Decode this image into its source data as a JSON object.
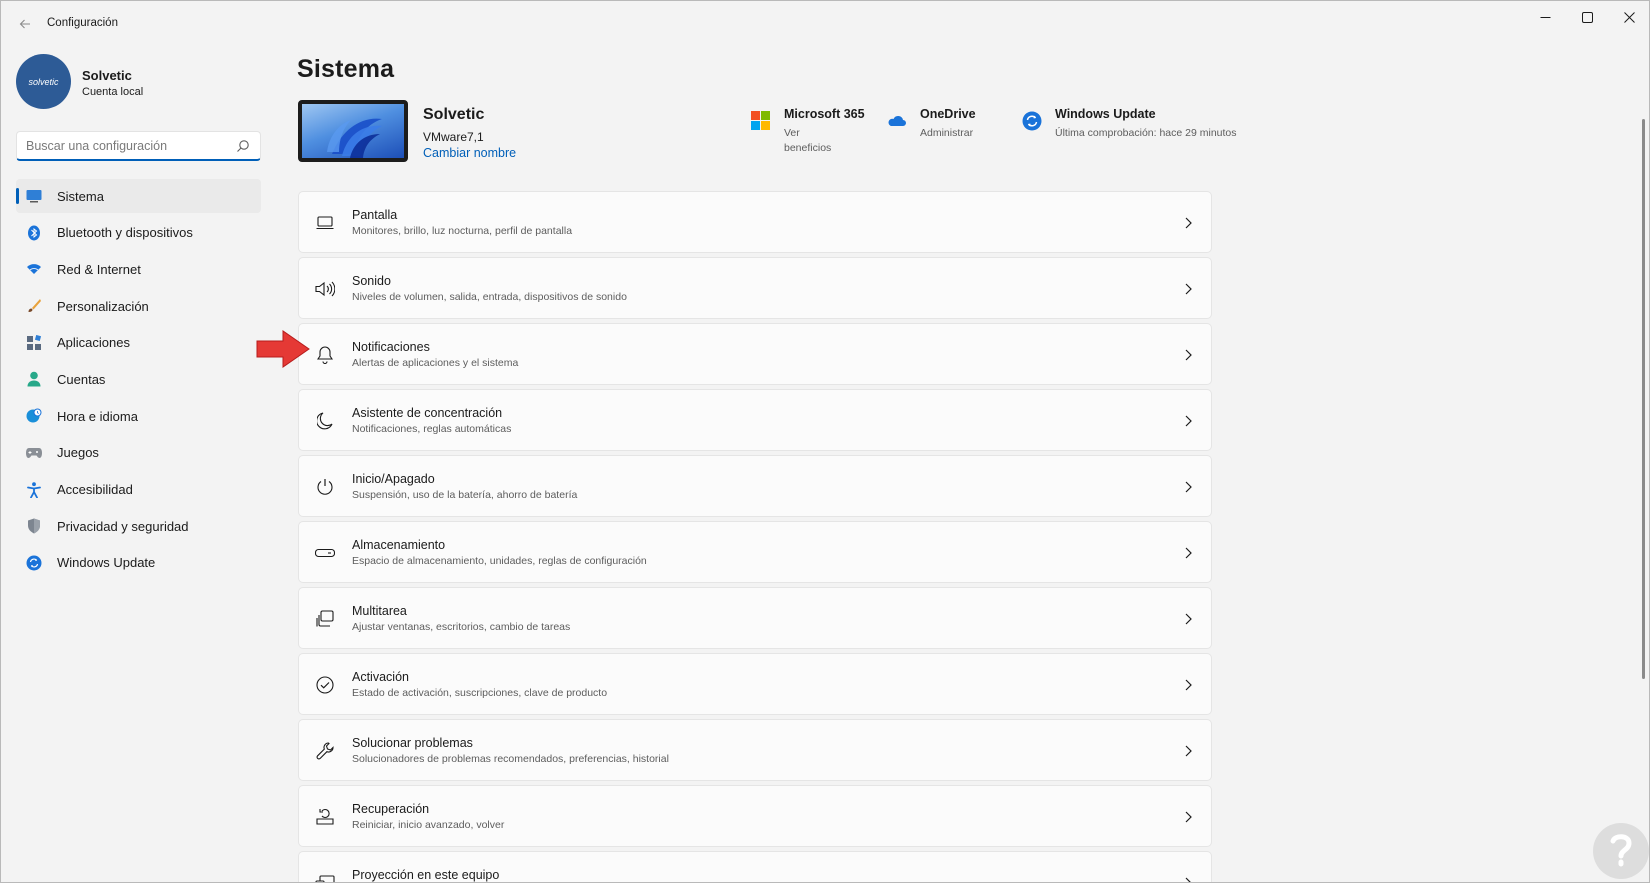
{
  "window": {
    "title": "Configuración"
  },
  "profile": {
    "name": "Solvetic",
    "account_type": "Cuenta local",
    "avatar_text": "solvetic"
  },
  "search": {
    "placeholder": "Buscar una configuración"
  },
  "sidebar": {
    "items": [
      {
        "label": "Sistema",
        "icon": "system-icon",
        "active": true
      },
      {
        "label": "Bluetooth y dispositivos",
        "icon": "bluetooth-icon",
        "active": false
      },
      {
        "label": "Red & Internet",
        "icon": "wifi-icon",
        "active": false
      },
      {
        "label": "Personalización",
        "icon": "brush-icon",
        "active": false
      },
      {
        "label": "Aplicaciones",
        "icon": "apps-icon",
        "active": false
      },
      {
        "label": "Cuentas",
        "icon": "account-icon",
        "active": false
      },
      {
        "label": "Hora e idioma",
        "icon": "globe-clock-icon",
        "active": false
      },
      {
        "label": "Juegos",
        "icon": "gamepad-icon",
        "active": false
      },
      {
        "label": "Accesibilidad",
        "icon": "accessibility-icon",
        "active": false
      },
      {
        "label": "Privacidad y seguridad",
        "icon": "shield-icon",
        "active": false
      },
      {
        "label": "Windows Update",
        "icon": "update-icon",
        "active": false
      }
    ]
  },
  "main": {
    "page_title": "Sistema",
    "device": {
      "name": "Solvetic",
      "model": "VMware7,1",
      "rename_link": "Cambiar nombre"
    },
    "quick_links": [
      {
        "title": "Microsoft 365",
        "subtitle": "Ver beneficios",
        "icon": "microsoft-logo-icon"
      },
      {
        "title": "OneDrive",
        "subtitle": "Administrar",
        "icon": "onedrive-cloud-icon"
      },
      {
        "title": "Windows Update",
        "subtitle": "Última comprobación: hace 29 minutos",
        "icon": "update-icon"
      }
    ],
    "settings": [
      {
        "title": "Pantalla",
        "subtitle": "Monitores, brillo, luz nocturna, perfil de pantalla",
        "icon": "display-icon"
      },
      {
        "title": "Sonido",
        "subtitle": "Niveles de volumen, salida, entrada, dispositivos de sonido",
        "icon": "speaker-icon"
      },
      {
        "title": "Notificaciones",
        "subtitle": "Alertas de aplicaciones y el sistema",
        "icon": "bell-icon"
      },
      {
        "title": "Asistente de concentración",
        "subtitle": "Notificaciones, reglas automáticas",
        "icon": "moon-icon"
      },
      {
        "title": "Inicio/Apagado",
        "subtitle": "Suspensión, uso de la batería, ahorro de batería",
        "icon": "power-icon"
      },
      {
        "title": "Almacenamiento",
        "subtitle": "Espacio de almacenamiento, unidades, reglas de configuración",
        "icon": "storage-icon"
      },
      {
        "title": "Multitarea",
        "subtitle": "Ajustar ventanas, escritorios, cambio de tareas",
        "icon": "multitask-icon"
      },
      {
        "title": "Activación",
        "subtitle": "Estado de activación, suscripciones, clave de producto",
        "icon": "check-circle-icon"
      },
      {
        "title": "Solucionar problemas",
        "subtitle": "Solucionadores de problemas recomendados, preferencias, historial",
        "icon": "wrench-icon"
      },
      {
        "title": "Recuperación",
        "subtitle": "Reiniciar, inicio avanzado, volver",
        "icon": "recovery-icon"
      },
      {
        "title": "Proyección en este equipo",
        "subtitle": "",
        "icon": "projection-icon"
      }
    ]
  },
  "colors": {
    "accent": "#005fb8",
    "background": "#f3f3f3",
    "card": "#fbfbfb",
    "annotation_arrow": "#e53935"
  }
}
